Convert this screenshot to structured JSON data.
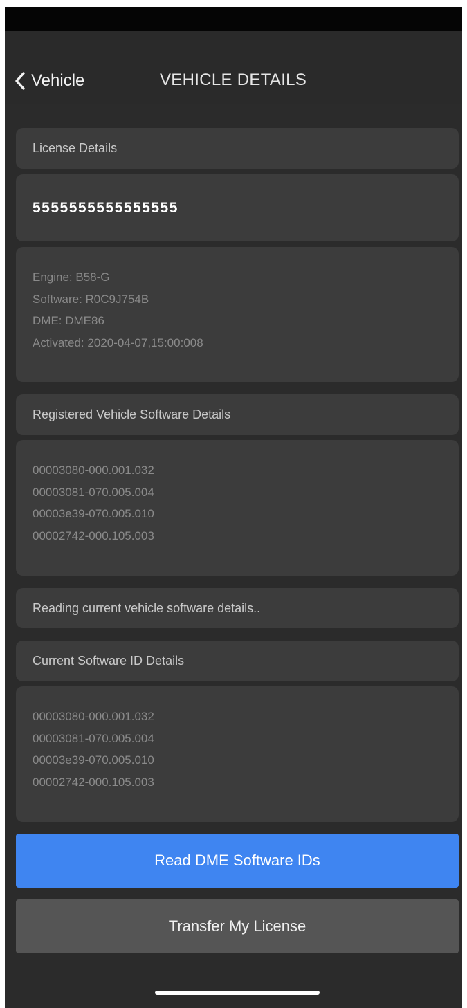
{
  "nav": {
    "back_label": "Vehicle",
    "title": "VEHICLE DETAILS"
  },
  "license_details": {
    "header": "License Details",
    "license_number": "5555555555555555",
    "info_lines": [
      "Engine: B58-G",
      "Software: R0C9J754B",
      "DME: DME86",
      "Activated: 2020-04-07,15:00:008"
    ]
  },
  "registered_software": {
    "header": "Registered Vehicle Software Details",
    "ids": [
      "00003080-000.001.032",
      "00003081-070.005.004",
      "00003e39-070.005.010",
      "00002742-000.105.003"
    ]
  },
  "status_message": "Reading current vehicle software details..",
  "current_software": {
    "header": "Current Software ID Details",
    "ids": [
      "00003080-000.001.032",
      "00003081-070.005.004",
      "00003e39-070.005.010",
      "00002742-000.105.003"
    ]
  },
  "buttons": {
    "read_dme": "Read DME Software IDs",
    "transfer_license": "Transfer My License"
  },
  "colors": {
    "accent": "#3f85f1",
    "background": "#2b2b2b",
    "card": "#3c3c3c",
    "secondary_button": "#555555"
  },
  "icons": {
    "back": "chevron-left-icon"
  }
}
